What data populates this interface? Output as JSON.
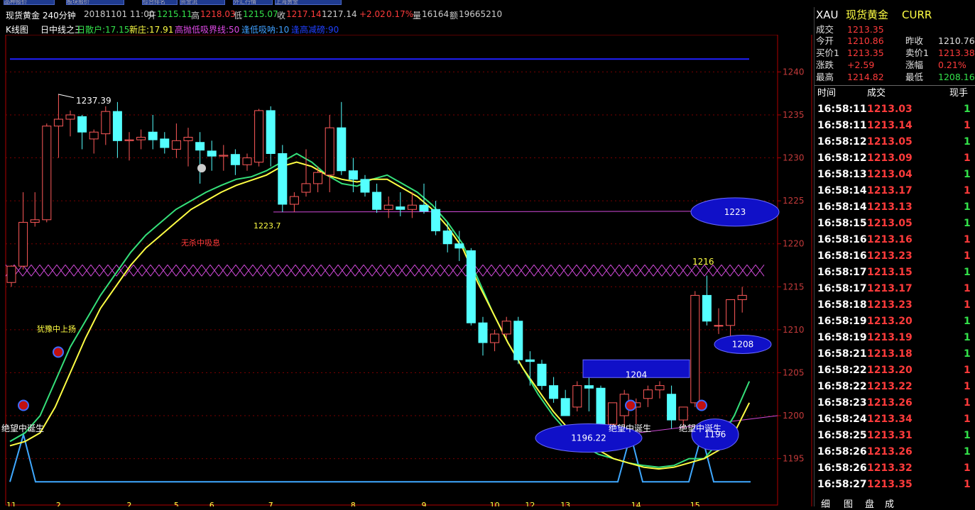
{
  "tabs": [
    "品种报价",
    "板块报价",
    "综合排名",
    "资金流",
    "外汇行情",
    "上海黄金"
  ],
  "header": {
    "symbol": "现货黄金 240分钟",
    "datetime": "20181101 11:00",
    "open_label": "开",
    "open": "1215.11",
    "high_label": "高",
    "high": "1218.03",
    "low_label": "低",
    "low": "1215.07",
    "close_label": "收",
    "close": "1217.14",
    "last": "1217.14",
    "change": "+2.02",
    "change_pct": "0.17%",
    "volume_label": "量",
    "volume": "16164",
    "amount_label": "额",
    "amount": "19665210"
  },
  "indicator_bar": {
    "kline": "K线图",
    "name": "日中线之王",
    "retail": "日散户:17.15",
    "new_dealer": "新庄:17.91",
    "high_low_line": "高抛低吸界线:50",
    "buy_low": "逢低吸呐:10",
    "sell_high": "逢高减磅:90"
  },
  "chart_data": {
    "type": "candlestick",
    "ylim": [
      1191.5,
      1243.5
    ],
    "y_ticks": [
      1195,
      1200,
      1205,
      1210,
      1215,
      1220,
      1225,
      1230,
      1235,
      1240
    ],
    "x_tick_labels": [
      "11",
      "2",
      "2",
      "5",
      "6",
      "7",
      "8",
      "9",
      "10",
      "12",
      "13",
      "14",
      "15"
    ],
    "candles": [
      [
        1215.5,
        1217.5,
        1215.0,
        1217.4
      ],
      [
        1217.4,
        1226.0,
        1217.0,
        1222.5
      ],
      [
        1222.5,
        1226.0,
        1222.0,
        1222.8
      ],
      [
        1222.8,
        1234.0,
        1222.5,
        1233.7
      ],
      [
        1233.7,
        1237.4,
        1230.0,
        1234.5
      ],
      [
        1234.5,
        1235.5,
        1232.5,
        1235.0
      ],
      [
        1234.8,
        1235.0,
        1231.0,
        1233.0
      ],
      [
        1232.2,
        1233.3,
        1230.5,
        1233.0
      ],
      [
        1232.8,
        1236.0,
        1231.5,
        1235.4
      ],
      [
        1235.4,
        1236.5,
        1230.0,
        1232.0
      ],
      [
        1232.0,
        1233.0,
        1229.7,
        1232.1
      ],
      [
        1232.1,
        1233.3,
        1231.0,
        1232.4
      ],
      [
        1233.0,
        1235.0,
        1231.0,
        1232.1
      ],
      [
        1232.2,
        1233.0,
        1230.5,
        1231.2
      ],
      [
        1231.0,
        1234.0,
        1230.0,
        1232.0
      ],
      [
        1232.0,
        1233.5,
        1229.0,
        1232.4
      ],
      [
        1231.8,
        1233.0,
        1227.0,
        1230.9
      ],
      [
        1230.8,
        1232.0,
        1228.5,
        1230.2
      ],
      [
        1230.2,
        1231.5,
        1228.5,
        1230.3
      ],
      [
        1230.4,
        1231.0,
        1228.0,
        1229.2
      ],
      [
        1229.2,
        1230.5,
        1228.5,
        1230.0
      ],
      [
        1229.5,
        1235.7,
        1229.0,
        1235.5
      ],
      [
        1235.5,
        1236.0,
        1229.0,
        1230.5
      ],
      [
        1230.5,
        1231.5,
        1223.7,
        1224.6
      ],
      [
        1224.6,
        1226.0,
        1223.7,
        1225.5
      ],
      [
        1226.0,
        1231.0,
        1225.5,
        1227.0
      ],
      [
        1227.0,
        1229.0,
        1226.0,
        1228.3
      ],
      [
        1228.0,
        1235.0,
        1226.0,
        1233.5
      ],
      [
        1233.5,
        1236.5,
        1228.0,
        1228.5
      ],
      [
        1228.5,
        1230.0,
        1226.0,
        1227.5
      ],
      [
        1227.5,
        1228.0,
        1225.5,
        1226.0
      ],
      [
        1226.0,
        1227.0,
        1223.6,
        1224.0
      ],
      [
        1224.0,
        1225.5,
        1223.0,
        1224.5
      ],
      [
        1224.3,
        1226.0,
        1223.2,
        1224.0
      ],
      [
        1224.0,
        1226.0,
        1223.0,
        1224.5
      ],
      [
        1224.5,
        1227.0,
        1223.5,
        1223.8
      ],
      [
        1224.0,
        1225.0,
        1221.0,
        1221.5
      ],
      [
        1221.5,
        1222.5,
        1219.0,
        1220.0
      ],
      [
        1220.0,
        1221.5,
        1218.0,
        1219.5
      ],
      [
        1219.2,
        1219.5,
        1210.5,
        1210.8
      ],
      [
        1210.8,
        1211.5,
        1207.0,
        1208.5
      ],
      [
        1208.5,
        1210.0,
        1207.5,
        1209.5
      ],
      [
        1209.5,
        1211.5,
        1209.0,
        1211.0
      ],
      [
        1211.0,
        1211.5,
        1206.0,
        1206.5
      ],
      [
        1206.5,
        1207.5,
        1203.5,
        1206.3
      ],
      [
        1206.0,
        1206.5,
        1203.0,
        1203.5
      ],
      [
        1203.5,
        1204.5,
        1201.5,
        1202.0
      ],
      [
        1202.0,
        1203.0,
        1200.0,
        1200.0
      ],
      [
        1201.0,
        1204.0,
        1200.5,
        1203.5
      ],
      [
        1203.5,
        1205.0,
        1200.5,
        1203.2
      ],
      [
        1203.2,
        1203.5,
        1197.5,
        1198.0
      ],
      [
        1199.0,
        1201.0,
        1196.2,
        1201.5
      ],
      [
        1200.0,
        1203.0,
        1197.5,
        1202.5
      ],
      [
        1201.0,
        1202.0,
        1199.0,
        1201.5
      ],
      [
        1202.0,
        1203.5,
        1201.0,
        1203.0
      ],
      [
        1203.0,
        1204.0,
        1202.0,
        1203.5
      ],
      [
        1202.5,
        1203.5,
        1198.5,
        1199.5
      ],
      [
        1199.5,
        1201.0,
        1198.5,
        1201.0
      ],
      [
        1201.5,
        1214.5,
        1201.0,
        1214.0
      ],
      [
        1214.0,
        1216.3,
        1210.5,
        1211.0
      ],
      [
        1210.5,
        1212.5,
        1209.5,
        1210.5
      ],
      [
        1210.5,
        1213.5,
        1209.0,
        1213.5
      ],
      [
        1213.5,
        1215.0,
        1212.0,
        1214.0
      ]
    ],
    "green_line": [
      1197,
      1198,
      1200,
      1204,
      1208,
      1211,
      1214,
      1216.5,
      1219,
      1221,
      1222.5,
      1224,
      1225,
      1226,
      1226.8,
      1227.5,
      1227.8,
      1228.5,
      1229.5,
      1230.5,
      1229.5,
      1228,
      1227,
      1226.7,
      1227.5,
      1228,
      1227,
      1226,
      1224.5,
      1222.5,
      1220,
      1216,
      1212,
      1208.5,
      1205.5,
      1202.5,
      1200,
      1198,
      1196.5,
      1195.5,
      1195,
      1194.5,
      1194.2,
      1194.0,
      1194.2,
      1195,
      1195,
      1197,
      1200,
      1204
    ],
    "yellow_line": [
      1196.5,
      1197,
      1198,
      1201,
      1205,
      1209,
      1212.5,
      1215,
      1217.5,
      1219.5,
      1221,
      1222.5,
      1224,
      1225,
      1226,
      1226.8,
      1227.4,
      1228,
      1229,
      1229.5,
      1229,
      1228,
      1227.5,
      1227.2,
      1227.5,
      1227.5,
      1226.5,
      1225.5,
      1224,
      1222,
      1219.5,
      1215.5,
      1212,
      1208.5,
      1205.5,
      1203,
      1200.5,
      1198.5,
      1197,
      1196,
      1195,
      1194.5,
      1194,
      1193.8,
      1194.0,
      1194.5,
      1195,
      1196,
      1198,
      1201.5
    ],
    "pink_cross_band": 1216.9,
    "blue_line_value": 1241.5,
    "magenta_line_value": 1223.7,
    "labels": {
      "peak": "1237.39",
      "support": "1223.7",
      "hesitation": "犹豫中上扬",
      "no_kill": "无杀中吸息",
      "despair1": "绝望中诞生",
      "despair2": "绝望中诞生",
      "despair3": "绝望中诞生",
      "bubble_1223": "1223",
      "bubble_1216": "1216",
      "bubble_1208": "1208",
      "bubble_1204": "1204",
      "bubble_119622": "1196.22",
      "bubble_1196": "1196"
    }
  },
  "quote": {
    "code": "XAU",
    "name": "现货黄金",
    "currency": "CURR",
    "rows": [
      {
        "l1": "成交",
        "v1": "1213.35",
        "c1": "#ff3b3b"
      },
      {
        "l1": "今开",
        "v1": "1210.86",
        "c1": "#ff3b3b",
        "l2": "昨收",
        "v2": "1210.76",
        "c2": "#e0e0e0"
      },
      {
        "l1": "买价1",
        "v1": "1213.35",
        "c1": "#ff3b3b",
        "l2": "卖价1",
        "v2": "1213.38",
        "c2": "#ff3b3b"
      },
      {
        "l1": "涨跌",
        "v1": "+2.59",
        "c1": "#ff3b3b",
        "l2": "涨幅",
        "v2": "0.21%",
        "c2": "#ff3b3b"
      },
      {
        "l1": "最高",
        "v1": "1214.82",
        "c1": "#ff3b3b",
        "l2": "最低",
        "v2": "1208.16",
        "c2": "#33e24a"
      }
    ]
  },
  "trades": {
    "headers": [
      "时间",
      "成交",
      "现手"
    ],
    "rows": [
      {
        "time": "16:58:11",
        "price": "1213.03",
        "vol": "1",
        "pc": "#ff3b3b",
        "vc": "#33e24a"
      },
      {
        "time": "16:58:11",
        "price": "1213.14",
        "vol": "1",
        "pc": "#ff3b3b",
        "vc": "#ff3b3b"
      },
      {
        "time": "16:58:12",
        "price": "1213.05",
        "vol": "1",
        "pc": "#ff3b3b",
        "vc": "#33e24a"
      },
      {
        "time": "16:58:12",
        "price": "1213.09",
        "vol": "1",
        "pc": "#ff3b3b",
        "vc": "#ff3b3b"
      },
      {
        "time": "16:58:13",
        "price": "1213.04",
        "vol": "1",
        "pc": "#ff3b3b",
        "vc": "#33e24a"
      },
      {
        "time": "16:58:14",
        "price": "1213.17",
        "vol": "1",
        "pc": "#ff3b3b",
        "vc": "#ff3b3b"
      },
      {
        "time": "16:58:14",
        "price": "1213.13",
        "vol": "1",
        "pc": "#ff3b3b",
        "vc": "#33e24a"
      },
      {
        "time": "16:58:15",
        "price": "1213.05",
        "vol": "1",
        "pc": "#ff3b3b",
        "vc": "#33e24a"
      },
      {
        "time": "16:58:16",
        "price": "1213.16",
        "vol": "1",
        "pc": "#ff3b3b",
        "vc": "#ff3b3b"
      },
      {
        "time": "16:58:16",
        "price": "1213.23",
        "vol": "1",
        "pc": "#ff3b3b",
        "vc": "#ff3b3b"
      },
      {
        "time": "16:58:17",
        "price": "1213.15",
        "vol": "1",
        "pc": "#ff3b3b",
        "vc": "#33e24a"
      },
      {
        "time": "16:58:17",
        "price": "1213.17",
        "vol": "1",
        "pc": "#ff3b3b",
        "vc": "#ff3b3b"
      },
      {
        "time": "16:58:18",
        "price": "1213.23",
        "vol": "1",
        "pc": "#ff3b3b",
        "vc": "#ff3b3b"
      },
      {
        "time": "16:58:19",
        "price": "1213.20",
        "vol": "1",
        "pc": "#ff3b3b",
        "vc": "#33e24a"
      },
      {
        "time": "16:58:19",
        "price": "1213.19",
        "vol": "1",
        "pc": "#ff3b3b",
        "vc": "#33e24a"
      },
      {
        "time": "16:58:21",
        "price": "1213.18",
        "vol": "1",
        "pc": "#ff3b3b",
        "vc": "#33e24a"
      },
      {
        "time": "16:58:22",
        "price": "1213.20",
        "vol": "1",
        "pc": "#ff3b3b",
        "vc": "#ff3b3b"
      },
      {
        "time": "16:58:22",
        "price": "1213.22",
        "vol": "1",
        "pc": "#ff3b3b",
        "vc": "#ff3b3b"
      },
      {
        "time": "16:58:23",
        "price": "1213.26",
        "vol": "1",
        "pc": "#ff3b3b",
        "vc": "#ff3b3b"
      },
      {
        "time": "16:58:24",
        "price": "1213.34",
        "vol": "1",
        "pc": "#ff3b3b",
        "vc": "#ff3b3b"
      },
      {
        "time": "16:58:25",
        "price": "1213.31",
        "vol": "1",
        "pc": "#ff3b3b",
        "vc": "#33e24a"
      },
      {
        "time": "16:58:26",
        "price": "1213.26",
        "vol": "1",
        "pc": "#ff3b3b",
        "vc": "#33e24a"
      },
      {
        "time": "16:58:26",
        "price": "1213.32",
        "vol": "1",
        "pc": "#ff3b3b",
        "vc": "#ff3b3b"
      },
      {
        "time": "16:58:27",
        "price": "1213.35",
        "vol": "1",
        "pc": "#ff3b3b",
        "vc": "#ff3b3b"
      }
    ]
  },
  "bottom_tabs": [
    "细",
    "图",
    "盘",
    "成"
  ],
  "colors": {
    "up": "#ff5a5a",
    "down": "#54ffff",
    "grid": "#7a0000",
    "axis_text": "#c33a3a",
    "green_line": "#35e07a",
    "yellow_line": "#ffff44",
    "pink": "#d04ad8",
    "blue": "#2020ff",
    "bubble": "#1010c8"
  }
}
